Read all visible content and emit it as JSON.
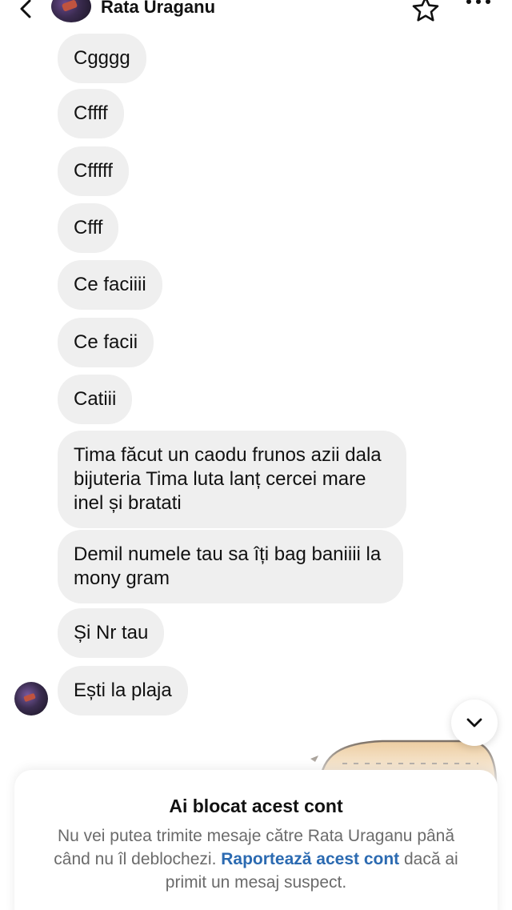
{
  "header": {
    "contact_name": "Rata Uraganu"
  },
  "messages": [
    {
      "text": "Cgggg"
    },
    {
      "text": "Cffff"
    },
    {
      "text": "Cfffff"
    },
    {
      "text": "Cfff"
    },
    {
      "text": "Ce faciiii"
    },
    {
      "text": "Ce facii"
    },
    {
      "text": "Catiii"
    },
    {
      "text": "Tima făcut un caodu frunos azii dala bijuteria Tima luta lanț cercei mare inel și bratati"
    },
    {
      "text": "Demil numele tau sa îți bag baniiii la mony gram"
    },
    {
      "text": "Și Nr tau"
    },
    {
      "text": "Ești la plaja"
    }
  ],
  "blocked_notice": {
    "title": "Ai blocat acest cont",
    "body_before_link": "Nu vei putea trimite mesaje către Rata Uraganu până când nu îl deblochezi. ",
    "link_text": "Raportează acest cont",
    "body_after_link": " dacă ai primit un mesaj suspect."
  },
  "colors": {
    "bubble_bg": "#efefef",
    "link": "#2b6ab1",
    "muted_text": "#6b6b6b"
  },
  "icons": {
    "back": "chevron-left-icon",
    "favorite": "star-outline-icon",
    "more": "more-horizontal-icon",
    "scroll_down": "chevron-down-icon"
  }
}
